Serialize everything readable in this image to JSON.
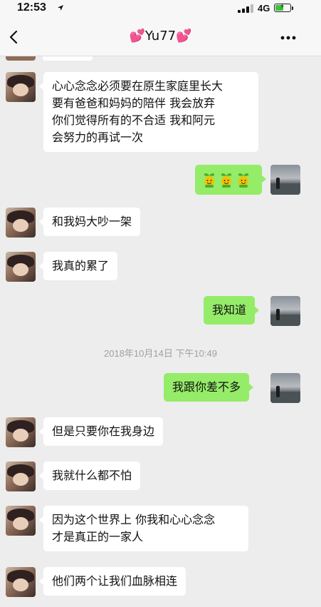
{
  "status_bar": {
    "time": "12:53",
    "network": "4G",
    "battery_level": 0.52
  },
  "nav": {
    "title": "💕Yu77💕",
    "back_icon": "chevron-left-icon",
    "more_icon": "ellipsis-icon"
  },
  "messages": [
    {
      "side": "left",
      "text": "心心念念必须要在原生家庭里长大\n要有爸爸和妈妈的陪伴 我会放弃\n你们觉得所有的不合适 我和阿元\n会努力的再试一次"
    },
    {
      "side": "right",
      "emoji": [
        "sprout-face-emoji",
        "sprout-face-emoji",
        "sprout-face-emoji"
      ]
    },
    {
      "side": "left",
      "text": "和我妈大吵一架"
    },
    {
      "side": "left",
      "text": "我真的累了"
    },
    {
      "side": "right",
      "text": "我知道"
    },
    {
      "side": "right",
      "text": "我跟你差不多"
    },
    {
      "side": "left",
      "text": "但是只要你在我身边"
    },
    {
      "side": "left",
      "text": "我就什么都不怕"
    },
    {
      "side": "left",
      "text": "因为这个世界上 你我和心心念念\n才是真正的一家人"
    },
    {
      "side": "left",
      "text": "他们两个让我们血脉相连"
    }
  ],
  "timestamp": "2018年10月14日 下午10:49"
}
